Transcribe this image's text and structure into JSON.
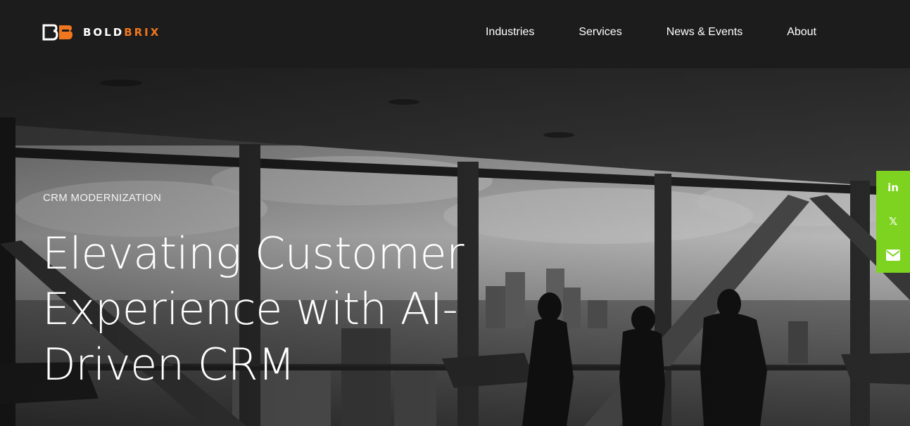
{
  "brand": {
    "name_part1": "BOLD",
    "name_part2": "BRIX",
    "accent_color": "#f0761f"
  },
  "nav": {
    "items": [
      {
        "label": "Industries"
      },
      {
        "label": "Services"
      },
      {
        "label": "News & Events"
      },
      {
        "label": "About"
      }
    ]
  },
  "hero": {
    "eyebrow": "CRM MODERNIZATION",
    "title": "Elevating Customer Experience with AI-Driven CRM"
  },
  "share": {
    "color": "#7ed321",
    "buttons": [
      {
        "icon": "linkedin-icon",
        "glyph": "in"
      },
      {
        "icon": "x-icon",
        "glyph": "𝕏"
      },
      {
        "icon": "email-icon",
        "glyph": "✉"
      }
    ]
  }
}
